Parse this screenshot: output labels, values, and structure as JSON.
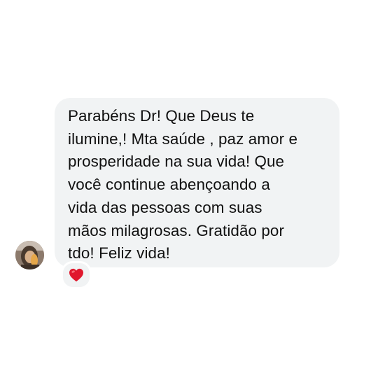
{
  "message": {
    "lines": [
      "Parabéns Dr! Que Deus te",
      "ilumine,! Mta saúde , paz amor e",
      "prosperidade na sua vida! Que",
      "você continue abençoando a",
      "vida das pessoas com suas",
      "mãos milagrosas. Gratidão por",
      "tdo! Feliz vida!"
    ]
  },
  "sender": {
    "avatar_icon": "profile-photo"
  },
  "reaction": {
    "icon": "red-heart-icon",
    "color": "#e0182d"
  },
  "colors": {
    "bubble": "#f1f3f4",
    "text": "#111111",
    "background": "#ffffff"
  }
}
